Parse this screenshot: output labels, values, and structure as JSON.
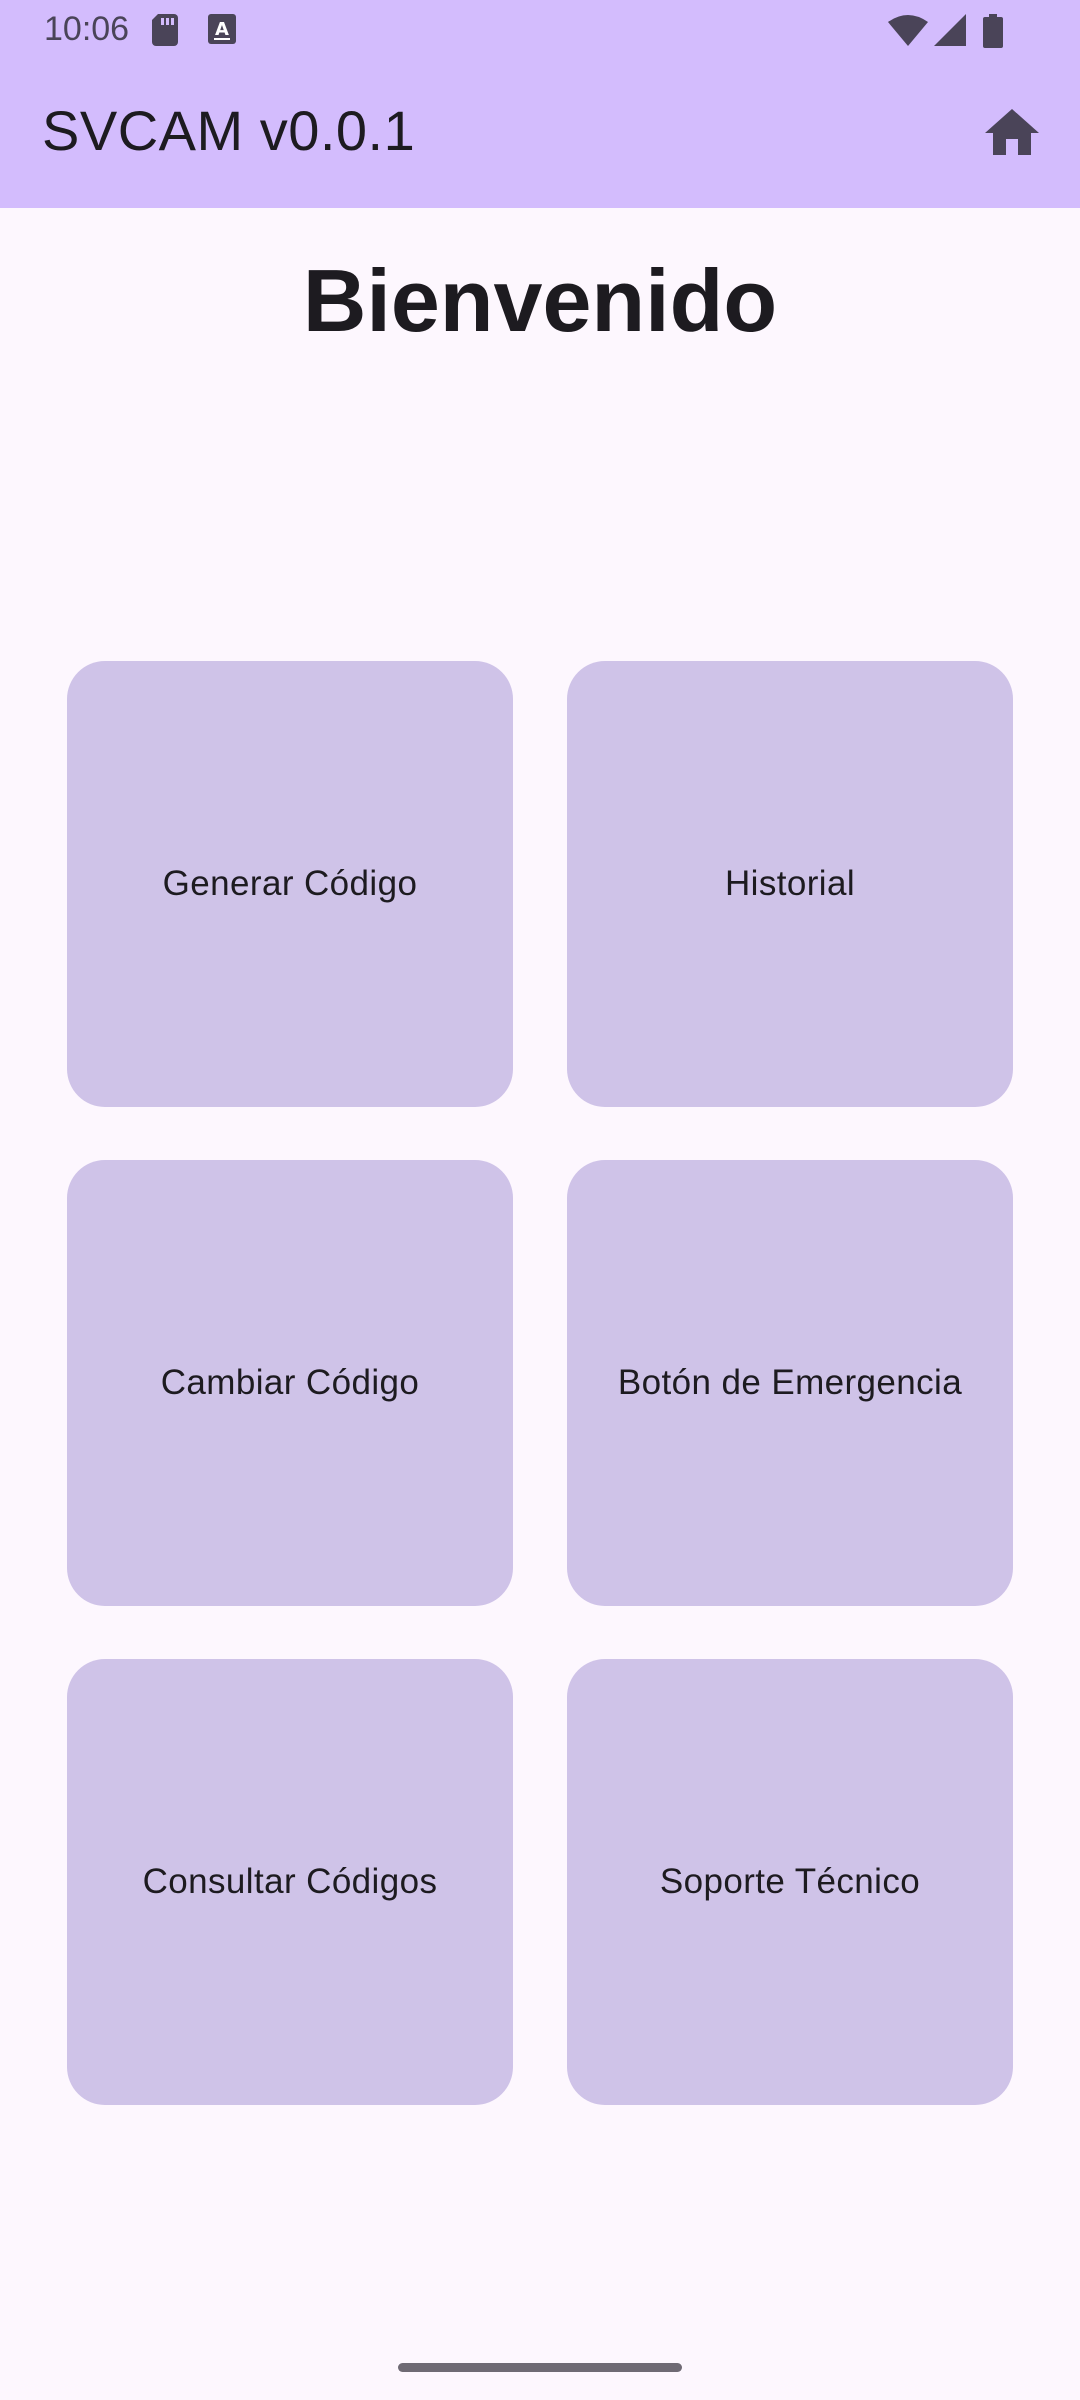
{
  "status_bar": {
    "time": "10:06",
    "icons": [
      "sd-card-icon",
      "keyboard-a-icon",
      "wifi-icon",
      "signal-icon",
      "battery-icon"
    ]
  },
  "app_bar": {
    "title": "SVCAM v0.0.1",
    "action_icon": "home-icon"
  },
  "page": {
    "title": "Bienvenido"
  },
  "menu": {
    "items": [
      {
        "label": "Generar Código"
      },
      {
        "label": "Historial"
      },
      {
        "label": "Cambiar Código"
      },
      {
        "label": "Botón de Emergencia"
      },
      {
        "label": "Consultar Códigos"
      },
      {
        "label": "Soporte Técnico"
      }
    ]
  },
  "colors": {
    "app_bar": "#d3bcfd",
    "background": "#fdf7fe",
    "tile": "#cfc3e8",
    "text": "#1d1b20"
  }
}
